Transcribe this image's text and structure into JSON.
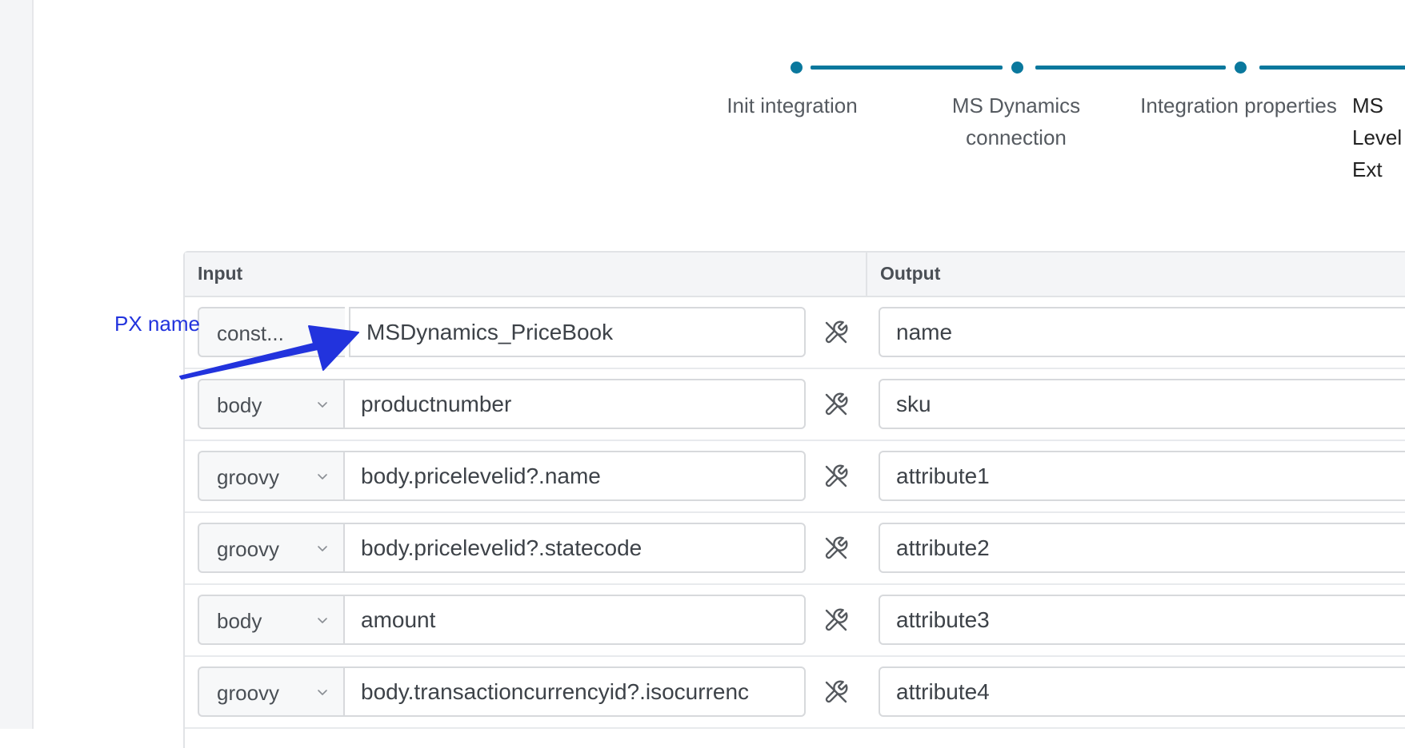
{
  "stepper": {
    "steps": [
      {
        "label": "Init integration"
      },
      {
        "label": "MS Dynamics\nconnection"
      },
      {
        "label": "Integration properties"
      },
      {
        "label": "MS \nLevel\nExt"
      }
    ],
    "color": "#0a789d"
  },
  "table": {
    "input_header": "Input",
    "output_header": "Output",
    "rows": [
      {
        "type": "const...",
        "value": "MSDynamics_PriceBook",
        "output": "name"
      },
      {
        "type": "body",
        "value": "productnumber",
        "output": "sku"
      },
      {
        "type": "groovy",
        "value": "body.pricelevelid?.name",
        "output": "attribute1"
      },
      {
        "type": "groovy",
        "value": "body.pricelevelid?.statecode",
        "output": "attribute2"
      },
      {
        "type": "body",
        "value": "amount",
        "output": "attribute3"
      },
      {
        "type": "groovy",
        "value": "body.transactioncurrencyid?.isocurrenc",
        "output": "attribute4"
      }
    ]
  },
  "annotation": {
    "label": "PX name",
    "color": "#2233dd"
  },
  "icons": {
    "row_action": "wrench-off-icon",
    "select": "chevron-down-icon"
  }
}
